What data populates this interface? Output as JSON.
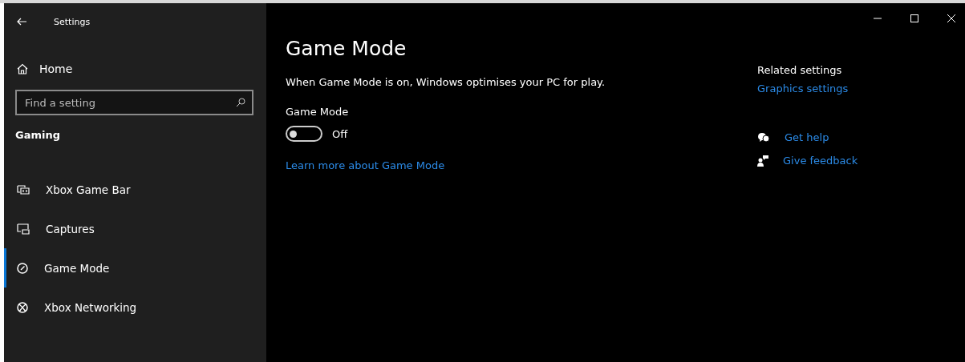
{
  "window": {
    "title": "Settings",
    "controls": [
      {
        "kind": "minimize"
      },
      {
        "kind": "maximize"
      },
      {
        "kind": "close"
      }
    ]
  },
  "sidebar": {
    "home": "Home",
    "search": {
      "placeholder": "Find a setting"
    },
    "section": "Gaming",
    "items": [
      {
        "label": "Xbox Game Bar",
        "kind": "gamebar",
        "selected": false
      },
      {
        "label": "Captures",
        "kind": "captures",
        "selected": false
      },
      {
        "label": "Game Mode",
        "kind": "gauge",
        "selected": true
      },
      {
        "label": "Xbox Networking",
        "kind": "xbox",
        "selected": false
      }
    ]
  },
  "main": {
    "title": "Game Mode",
    "description": "When Game Mode is on, Windows optimises your PC for play.",
    "setting": {
      "label": "Game Mode",
      "on": false,
      "state_text": "Off"
    },
    "link": "Learn more about Game Mode"
  },
  "related": {
    "heading": "Related settings",
    "links": [
      "Graphics settings"
    ],
    "support": [
      {
        "kind": "help",
        "label": "Get help"
      },
      {
        "kind": "feedback",
        "label": "Give feedback"
      }
    ]
  }
}
